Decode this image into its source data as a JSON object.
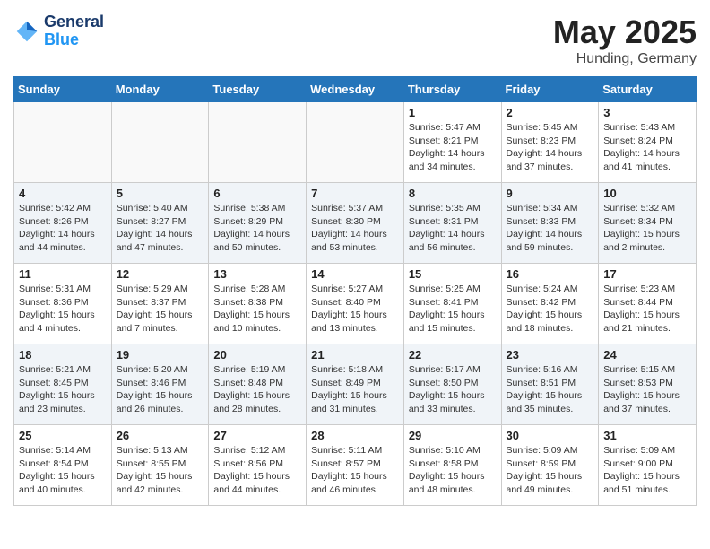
{
  "header": {
    "logo_general": "General",
    "logo_blue": "Blue",
    "title": "May 2025",
    "location": "Hunding, Germany"
  },
  "weekdays": [
    "Sunday",
    "Monday",
    "Tuesday",
    "Wednesday",
    "Thursday",
    "Friday",
    "Saturday"
  ],
  "weeks": [
    [
      {
        "day": "",
        "info": ""
      },
      {
        "day": "",
        "info": ""
      },
      {
        "day": "",
        "info": ""
      },
      {
        "day": "",
        "info": ""
      },
      {
        "day": "1",
        "info": "Sunrise: 5:47 AM\nSunset: 8:21 PM\nDaylight: 14 hours\nand 34 minutes."
      },
      {
        "day": "2",
        "info": "Sunrise: 5:45 AM\nSunset: 8:23 PM\nDaylight: 14 hours\nand 37 minutes."
      },
      {
        "day": "3",
        "info": "Sunrise: 5:43 AM\nSunset: 8:24 PM\nDaylight: 14 hours\nand 41 minutes."
      }
    ],
    [
      {
        "day": "4",
        "info": "Sunrise: 5:42 AM\nSunset: 8:26 PM\nDaylight: 14 hours\nand 44 minutes."
      },
      {
        "day": "5",
        "info": "Sunrise: 5:40 AM\nSunset: 8:27 PM\nDaylight: 14 hours\nand 47 minutes."
      },
      {
        "day": "6",
        "info": "Sunrise: 5:38 AM\nSunset: 8:29 PM\nDaylight: 14 hours\nand 50 minutes."
      },
      {
        "day": "7",
        "info": "Sunrise: 5:37 AM\nSunset: 8:30 PM\nDaylight: 14 hours\nand 53 minutes."
      },
      {
        "day": "8",
        "info": "Sunrise: 5:35 AM\nSunset: 8:31 PM\nDaylight: 14 hours\nand 56 minutes."
      },
      {
        "day": "9",
        "info": "Sunrise: 5:34 AM\nSunset: 8:33 PM\nDaylight: 14 hours\nand 59 minutes."
      },
      {
        "day": "10",
        "info": "Sunrise: 5:32 AM\nSunset: 8:34 PM\nDaylight: 15 hours\nand 2 minutes."
      }
    ],
    [
      {
        "day": "11",
        "info": "Sunrise: 5:31 AM\nSunset: 8:36 PM\nDaylight: 15 hours\nand 4 minutes."
      },
      {
        "day": "12",
        "info": "Sunrise: 5:29 AM\nSunset: 8:37 PM\nDaylight: 15 hours\nand 7 minutes."
      },
      {
        "day": "13",
        "info": "Sunrise: 5:28 AM\nSunset: 8:38 PM\nDaylight: 15 hours\nand 10 minutes."
      },
      {
        "day": "14",
        "info": "Sunrise: 5:27 AM\nSunset: 8:40 PM\nDaylight: 15 hours\nand 13 minutes."
      },
      {
        "day": "15",
        "info": "Sunrise: 5:25 AM\nSunset: 8:41 PM\nDaylight: 15 hours\nand 15 minutes."
      },
      {
        "day": "16",
        "info": "Sunrise: 5:24 AM\nSunset: 8:42 PM\nDaylight: 15 hours\nand 18 minutes."
      },
      {
        "day": "17",
        "info": "Sunrise: 5:23 AM\nSunset: 8:44 PM\nDaylight: 15 hours\nand 21 minutes."
      }
    ],
    [
      {
        "day": "18",
        "info": "Sunrise: 5:21 AM\nSunset: 8:45 PM\nDaylight: 15 hours\nand 23 minutes."
      },
      {
        "day": "19",
        "info": "Sunrise: 5:20 AM\nSunset: 8:46 PM\nDaylight: 15 hours\nand 26 minutes."
      },
      {
        "day": "20",
        "info": "Sunrise: 5:19 AM\nSunset: 8:48 PM\nDaylight: 15 hours\nand 28 minutes."
      },
      {
        "day": "21",
        "info": "Sunrise: 5:18 AM\nSunset: 8:49 PM\nDaylight: 15 hours\nand 31 minutes."
      },
      {
        "day": "22",
        "info": "Sunrise: 5:17 AM\nSunset: 8:50 PM\nDaylight: 15 hours\nand 33 minutes."
      },
      {
        "day": "23",
        "info": "Sunrise: 5:16 AM\nSunset: 8:51 PM\nDaylight: 15 hours\nand 35 minutes."
      },
      {
        "day": "24",
        "info": "Sunrise: 5:15 AM\nSunset: 8:53 PM\nDaylight: 15 hours\nand 37 minutes."
      }
    ],
    [
      {
        "day": "25",
        "info": "Sunrise: 5:14 AM\nSunset: 8:54 PM\nDaylight: 15 hours\nand 40 minutes."
      },
      {
        "day": "26",
        "info": "Sunrise: 5:13 AM\nSunset: 8:55 PM\nDaylight: 15 hours\nand 42 minutes."
      },
      {
        "day": "27",
        "info": "Sunrise: 5:12 AM\nSunset: 8:56 PM\nDaylight: 15 hours\nand 44 minutes."
      },
      {
        "day": "28",
        "info": "Sunrise: 5:11 AM\nSunset: 8:57 PM\nDaylight: 15 hours\nand 46 minutes."
      },
      {
        "day": "29",
        "info": "Sunrise: 5:10 AM\nSunset: 8:58 PM\nDaylight: 15 hours\nand 48 minutes."
      },
      {
        "day": "30",
        "info": "Sunrise: 5:09 AM\nSunset: 8:59 PM\nDaylight: 15 hours\nand 49 minutes."
      },
      {
        "day": "31",
        "info": "Sunrise: 5:09 AM\nSunset: 9:00 PM\nDaylight: 15 hours\nand 51 minutes."
      }
    ]
  ]
}
